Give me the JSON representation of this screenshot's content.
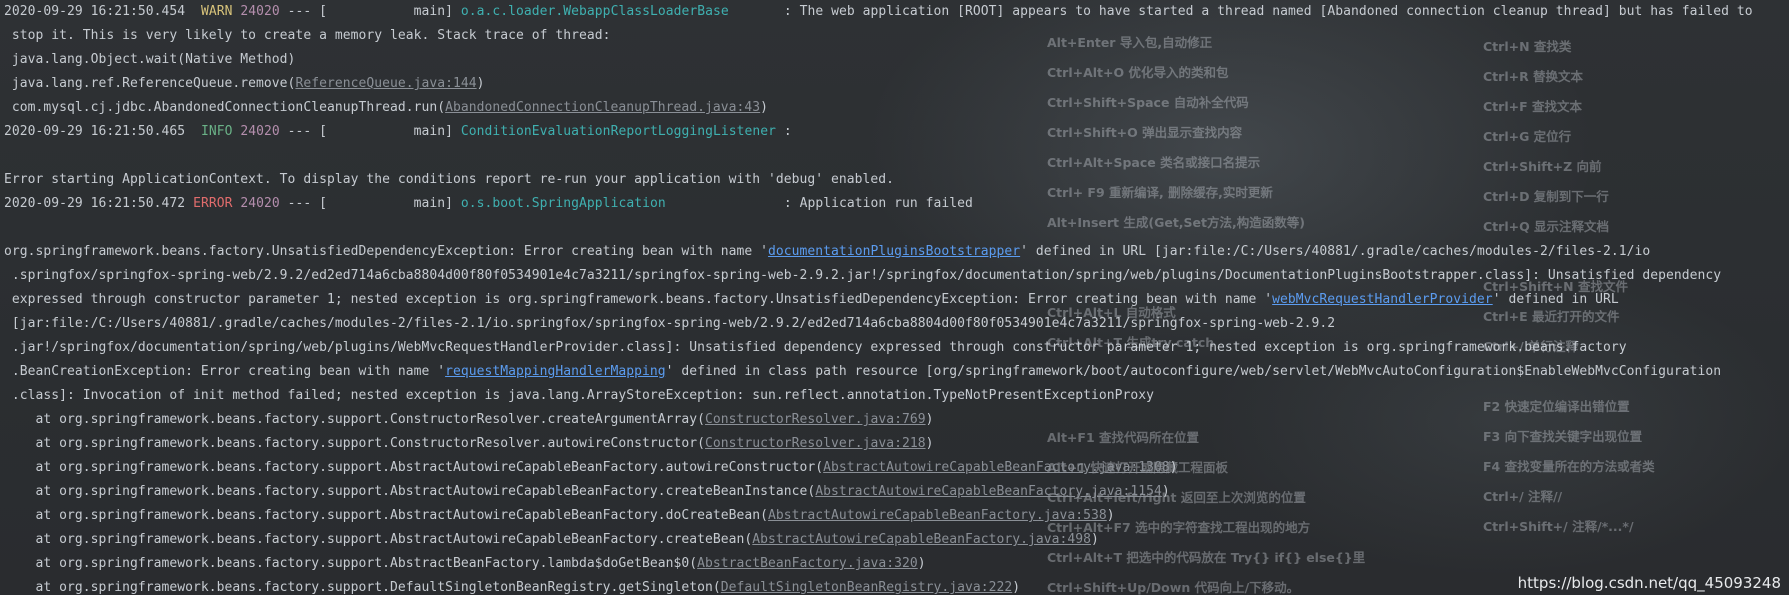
{
  "shortcuts": {
    "left": [
      "Alt+Enter 导入包,自动修正",
      "Ctrl+Alt+O  优化导入的类和包",
      "Ctrl+Shift+Space 自动补全代码",
      "Ctrl+Shift+O  弹出显示查找内容",
      "Ctrl+Alt+Space  类名或接口名提示",
      " Ctrl+ F9 重新编译, 删除缓存,实时更新",
      "Alt+Insert  生成(Get,Set方法,构造函数等)",
      "Ctrl+Alt+L 自动格式",
      "Ctrl+Alt+T  生成try catch",
      "Alt+F1 查找代码所在位置",
      "Alt+1 快速打开或隐藏工程面板",
      "Ctrl+Alt+left/right 返回至上次浏览的位置",
      "Ctrl+Alt+F7  选中的字符查找工程出现的地方",
      "Ctrl+Alt+T  把选中的代码放在 Try{} if{} else{}里",
      "Ctrl+Shift+Up/Down 代码向上/下移动。"
    ],
    "right": [
      "Ctrl+N   查找类",
      "Ctrl+R 替换文本",
      "Ctrl+F 查找文本",
      "Ctrl+G   定位行",
      "Ctrl+Shift+Z  向前",
      "Ctrl+D  复制到下一行",
      "Ctrl+Q   显示注释文档",
      "Ctrl+Shift+N 查找文件",
      "Ctrl+E 最近打开的文件",
      "Ctrl+/ 单行注释",
      "F2 快速定位编译出错位置",
      "F3   向下查找关键字出现位置",
      "F4   查找变量所在的方法或者类",
      "Ctrl+/   注释//",
      "Ctrl+Shift+/  注释/*...*/"
    ]
  },
  "log": {
    "warn": {
      "timestamp": "2020-09-29 16:21:50.454",
      "level": "WARN",
      "pid": "24020",
      "sep": " --- [",
      "thread": "           main] ",
      "logger": "o.a.c.loader.WebappClassLoaderBase       ",
      "message": ": The web application [ROOT] appears to have started a thread named [Abandoned connection cleanup thread] but has failed to",
      "cont": " stop it. This is very likely to create a memory leak. Stack trace of thread:",
      "frames": [
        {
          "text": " java.lang.Object.wait(Native Method)",
          "link": "",
          "close": ""
        },
        {
          "text": " java.lang.ref.ReferenceQueue.remove(",
          "link": "ReferenceQueue.java:144",
          "close": ")"
        },
        {
          "text": " com.mysql.cj.jdbc.AbandonedConnectionCleanupThread.run(",
          "link": "AbandonedConnectionCleanupThread.java:43",
          "close": ")"
        }
      ]
    },
    "info": {
      "timestamp": "2020-09-29 16:21:50.465",
      "level": "INFO",
      "pid": "24020",
      "sep": " --- [",
      "thread": "           main] ",
      "logger": "ConditionEvaluationReportLoggingListener",
      "message": " :"
    },
    "blank": "",
    "error_starting": "Error starting ApplicationContext. To display the conditions report re-run your application with 'debug' enabled.",
    "error": {
      "timestamp": "2020-09-29 16:21:50.472",
      "level": "ERROR",
      "pid": "24020",
      "sep": " --- [",
      "thread": "           main] ",
      "logger": "o.s.boot.SpringApplication               ",
      "message": ": Application run failed"
    },
    "exception": {
      "l1_a": "org.springframework.beans.factory.UnsatisfiedDependencyException: Error creating bean with name '",
      "l1_bean": "documentationPluginsBootstrapper",
      "l1_b": "' defined in URL [jar:file:/C:/Users/40881/.gradle/caches/modules-2/files-2.1/io",
      "l2": " .springfox/springfox-spring-web/2.9.2/ed2ed714a6cba8804d00f80f0534901e4c7a3211/springfox-spring-web-2.9.2.jar!/springfox/documentation/spring/web/plugins/DocumentationPluginsBootstrapper.class]: Unsatisfied dependency",
      "l3_a": " expressed through constructor parameter 1; nested exception is org.springframework.beans.factory.UnsatisfiedDependencyException: Error creating bean with name '",
      "l3_bean": "webMvcRequestHandlerProvider",
      "l3_b": "' defined in URL",
      "l4": " [jar:file:/C:/Users/40881/.gradle/caches/modules-2/files-2.1/io.springfox/springfox-spring-web/2.9.2/ed2ed714a6cba8804d00f80f0534901e4c7a3211/springfox-spring-web-2.9.2",
      "l5": " .jar!/springfox/documentation/spring/web/plugins/WebMvcRequestHandlerProvider.class]: Unsatisfied dependency expressed through constructor parameter 1; nested exception is org.springframework.beans.factory",
      "l6_a": " .BeanCreationException: Error creating bean with name '",
      "l6_bean": "requestMappingHandlerMapping",
      "l6_b": "' defined in class path resource [org/springframework/boot/autoconfigure/web/servlet/WebMvcAutoConfiguration$EnableWebMvcConfiguration",
      "l7": " .class]: Invocation of init method failed; nested exception is java.lang.ArrayStoreException: sun.reflect.annotation.TypeNotPresentExceptionProxy"
    },
    "stack": [
      {
        "text": "    at org.springframework.beans.factory.support.ConstructorResolver.createArgumentArray(",
        "link": "ConstructorResolver.java:769",
        "close": ")"
      },
      {
        "text": "    at org.springframework.beans.factory.support.ConstructorResolver.autowireConstructor(",
        "link": "ConstructorResolver.java:218",
        "close": ")"
      },
      {
        "text": "    at org.springframework.beans.factory.support.AbstractAutowireCapableBeanFactory.autowireConstructor(",
        "link": "AbstractAutowireCapableBeanFactory.java:1308",
        "close": ")"
      },
      {
        "text": "    at org.springframework.beans.factory.support.AbstractAutowireCapableBeanFactory.createBeanInstance(",
        "link": "AbstractAutowireCapableBeanFactory.java:1154",
        "close": ")"
      },
      {
        "text": "    at org.springframework.beans.factory.support.AbstractAutowireCapableBeanFactory.doCreateBean(",
        "link": "AbstractAutowireCapableBeanFactory.java:538",
        "close": ")"
      },
      {
        "text": "    at org.springframework.beans.factory.support.AbstractAutowireCapableBeanFactory.createBean(",
        "link": "AbstractAutowireCapableBeanFactory.java:498",
        "close": ")"
      },
      {
        "text": "    at org.springframework.beans.factory.support.AbstractBeanFactory.lambda$doGetBean$0(",
        "link": "AbstractBeanFactory.java:320",
        "close": ")"
      },
      {
        "text": "    at org.springframework.beans.factory.support.DefaultSingletonBeanRegistry.getSingleton(",
        "link": "DefaultSingletonBeanRegistry.java:222",
        "close": ")"
      }
    ]
  },
  "watermark": "https://blog.csdn.net/qq_45093248"
}
